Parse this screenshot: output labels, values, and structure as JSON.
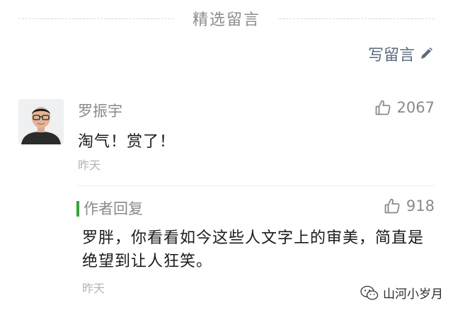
{
  "section": {
    "title": "精选留言"
  },
  "write_comment": {
    "label": "写留言",
    "icon": "pencil-icon"
  },
  "comment": {
    "author": "罗振宇",
    "avatar": "avatar",
    "likes": "2067",
    "text": "淘气！赏了！",
    "time": "昨天"
  },
  "reply": {
    "label": "作者回复",
    "likes": "918",
    "text": "罗胖，你看看如今这些人文字上的审美，简直是绝望到让人狂笑。",
    "time": "昨天"
  },
  "watermark": {
    "text": "山河小岁月",
    "icon": "wechat-icon"
  },
  "colors": {
    "accent_green": "#3aa33a",
    "secondary_text": "#8a8a8a",
    "link_text": "#5a6a7e"
  }
}
